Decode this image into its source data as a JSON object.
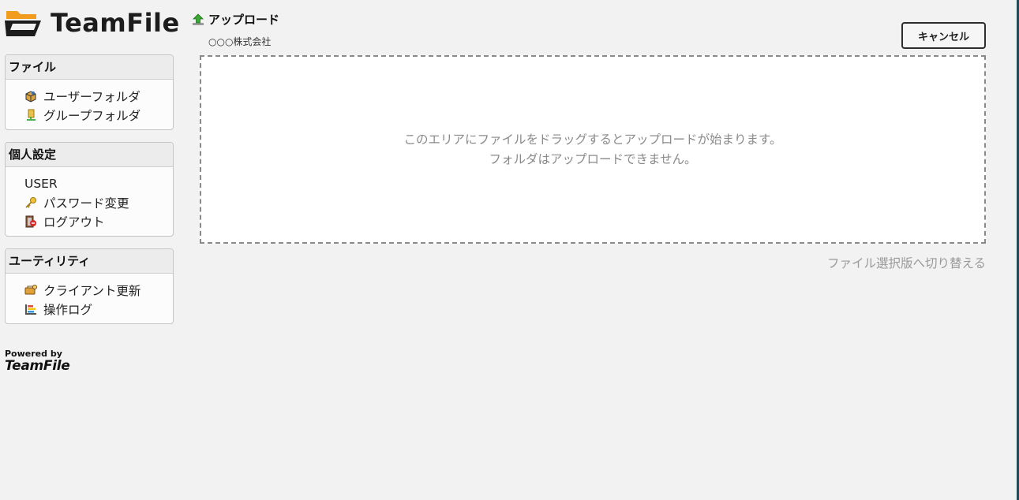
{
  "app": {
    "logo_text": "TeamFile",
    "powered_by": "Powered by",
    "powered_brand": "TeamFile"
  },
  "sidebar": {
    "file": {
      "header": "ファイル",
      "items": [
        {
          "label": "ユーザーフォルダ",
          "icon": "user-folder-icon"
        },
        {
          "label": "グループフォルダ",
          "icon": "group-folder-icon"
        }
      ]
    },
    "personal": {
      "header": "個人設定",
      "user": "USER",
      "items": [
        {
          "label": "パスワード変更",
          "icon": "key-icon"
        },
        {
          "label": "ログアウト",
          "icon": "logout-icon"
        }
      ]
    },
    "utility": {
      "header": "ユーティリティ",
      "items": [
        {
          "label": "クライアント更新",
          "icon": "client-update-icon"
        },
        {
          "label": "操作ログ",
          "icon": "operation-log-icon"
        }
      ]
    }
  },
  "main": {
    "title": "アップロード",
    "title_icon": "upload-arrow-icon",
    "subtitle": "○○○株式会社",
    "cancel_label": "キャンセル",
    "dropzone": {
      "line1": "このエリアにファイルをドラッグするとアップロードが始まります。",
      "line2": "フォルダはアップロードできません。"
    },
    "switch_link": "ファイル選択版へ切り替える"
  },
  "colors": {
    "logo_orange": "#f29c1f",
    "logo_dark": "#1c1c1c",
    "upload_green": "#3aa935",
    "edge": "#1f4a57"
  }
}
